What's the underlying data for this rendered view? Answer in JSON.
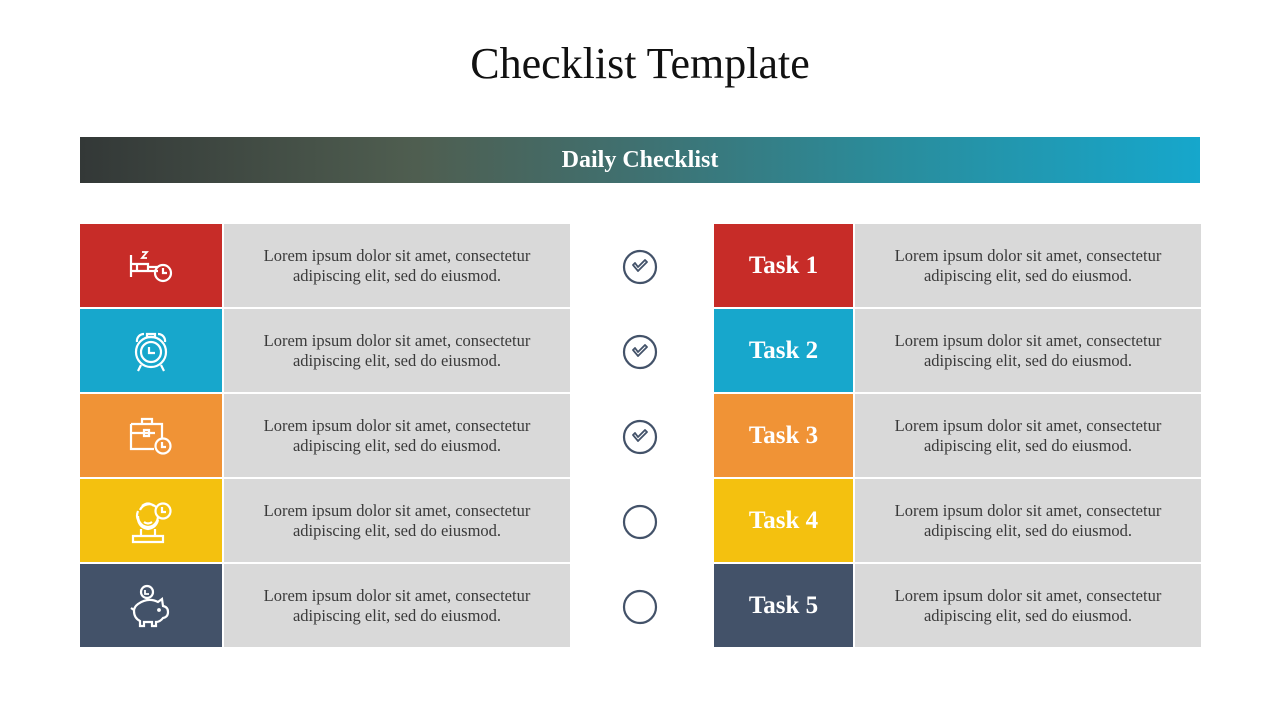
{
  "title": "Checklist Template",
  "banner": {
    "label": "Daily Checklist"
  },
  "colors": {
    "red": "#c72c28",
    "blue": "#17a7cc",
    "orange": "#f09336",
    "yellow": "#f4c10f",
    "navy": "#435269",
    "cell_gray": "#d9d9d9",
    "check_stroke": "#435269"
  },
  "left_rows": [
    {
      "icon": "sleep-bed-clock-icon",
      "text": "Lorem ipsum dolor sit amet, consectetur adipiscing  elit, sed do eiusmod."
    },
    {
      "icon": "alarm-clock-icon",
      "text": "Lorem ipsum dolor sit amet, consectetur adipiscing  elit, sed do eiusmod."
    },
    {
      "icon": "briefcase-clock-icon",
      "text": "Lorem ipsum dolor sit amet, consectetur adipiscing  elit, sed do eiusmod."
    },
    {
      "icon": "person-clock-icon",
      "text": "Lorem ipsum dolor sit amet, consectetur adipiscing  elit, sed do eiusmod."
    },
    {
      "icon": "piggy-bank-icon",
      "text": "Lorem ipsum dolor sit amet, consectetur adipiscing  elit, sed do eiusmod."
    }
  ],
  "checks": [
    {
      "checked": true
    },
    {
      "checked": true
    },
    {
      "checked": true
    },
    {
      "checked": false
    },
    {
      "checked": false
    }
  ],
  "right_rows": [
    {
      "label": "Task 1",
      "text": "Lorem ipsum dolor sit amet, consectetur adipiscing  elit, sed do eiusmod."
    },
    {
      "label": "Task 2",
      "text": "Lorem ipsum dolor sit amet, consectetur adipiscing  elit, sed do eiusmod."
    },
    {
      "label": "Task 3",
      "text": "Lorem ipsum dolor sit amet, consectetur adipiscing  elit, sed do eiusmod."
    },
    {
      "label": "Task 4",
      "text": "Lorem ipsum dolor sit amet, consectetur adipiscing  elit, sed do eiusmod."
    },
    {
      "label": "Task 5",
      "text": "Lorem ipsum dolor sit amet, consectetur adipiscing  elit, sed do eiusmod."
    }
  ]
}
